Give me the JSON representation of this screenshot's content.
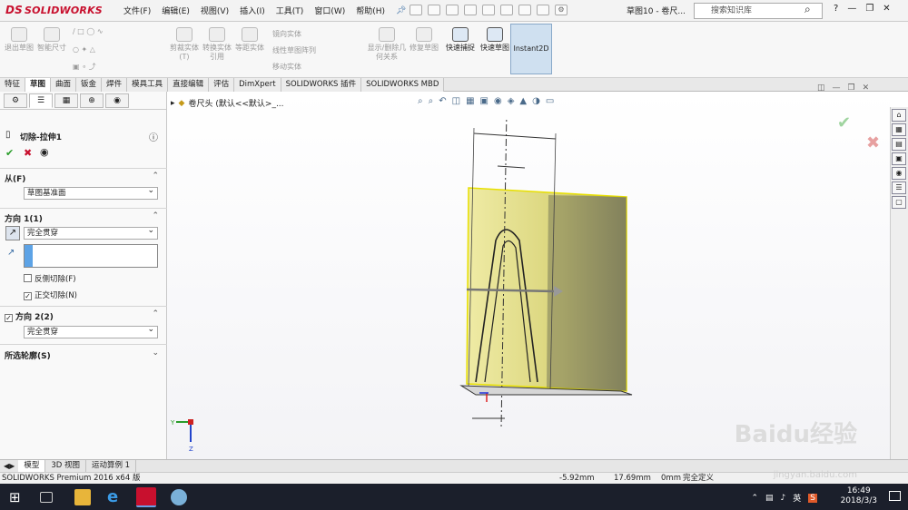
{
  "app": {
    "brand": "SOLIDWORKS",
    "doc_title": "草图10 - 卷尺...",
    "menus": [
      "文件(F)",
      "编辑(E)",
      "视图(V)",
      "插入(I)",
      "工具(T)",
      "窗口(W)",
      "帮助(H)"
    ]
  },
  "search": {
    "placeholder": "搜索知识库"
  },
  "ribbon": {
    "exit_sketch": "退出草图",
    "smart_dim": "智能尺寸",
    "trim": "剪裁实体(T)",
    "convert": "转换实体引用",
    "offset": "等距实体",
    "mirror": "镜向实体",
    "linear_pattern": "线性草图阵列",
    "move": "移动实体",
    "display_delete": "显示/删除几何关系",
    "repair": "修复草图",
    "quick_snap": "快速捕捉",
    "rapid_sketch": "快速草图",
    "instant2d": "Instant2D"
  },
  "tabs": [
    "特征",
    "草图",
    "曲面",
    "钣金",
    "焊件",
    "模具工具",
    "直接编辑",
    "评估",
    "DimXpert",
    "SOLIDWORKS 插件",
    "SOLIDWORKS MBD"
  ],
  "active_tab": "草图",
  "panel": {
    "title": "切除-拉伸1",
    "from_label": "从(F)",
    "from_value": "草图基准面",
    "dir1_label": "方向 1(1)",
    "dir1_value": "完全贯穿",
    "flip_label": "反侧切除(F)",
    "normal_label": "正交切除(N)",
    "dir2_label": "方向 2(2)",
    "dir2_value": "完全贯穿",
    "contours_label": "所选轮廓(S)"
  },
  "viewport": {
    "tree_label": "卷尺头 (默认<<默认>_..."
  },
  "bottom_tabs": [
    "模型",
    "3D 视图",
    "运动算例 1"
  ],
  "status": {
    "product": "SOLIDWORKS Premium 2016 x64 版",
    "x": "-5.92mm",
    "y": "17.69mm",
    "z": "0mm",
    "state": "完全定义"
  },
  "taskbar": {
    "time": "16:49",
    "date": "2018/3/3",
    "ime": "英"
  },
  "watermark": {
    "main": "Baidu经验",
    "sub": "jingyan.baidu.com"
  },
  "colors": {
    "accent": "#c8102e",
    "body_yellow": "#e8e48a",
    "check": "#2a9d2a"
  }
}
